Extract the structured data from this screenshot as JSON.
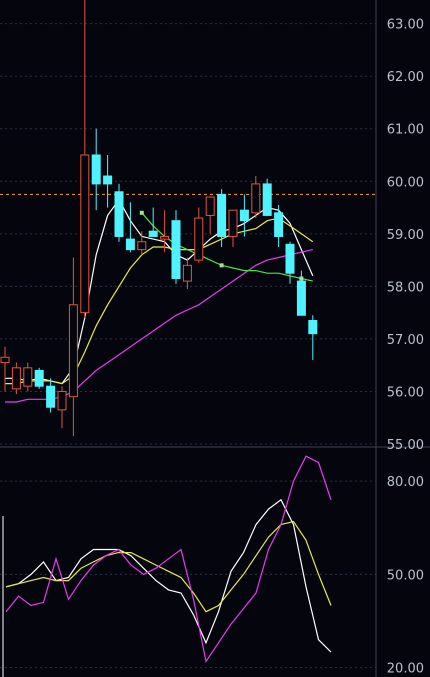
{
  "chart_data": [
    {
      "type": "candlestick",
      "panel": "price",
      "title": "",
      "xlabel": "",
      "ylabel": "",
      "ylim": [
        55.0,
        63.45
      ],
      "yticks": [
        "63.00",
        "62.00",
        "61.00",
        "60.00",
        "59.00",
        "58.00",
        "57.00",
        "56.00",
        "55.00"
      ],
      "grid": true,
      "reference_line": {
        "value": 59.75,
        "color": "#e08a2e",
        "style": "dashed"
      },
      "colors": {
        "up": "#e0553a",
        "down": "#4ff3ff",
        "background": "#05060d"
      },
      "candles": [
        {
          "open": 56.55,
          "high": 56.85,
          "low": 56.0,
          "close": 56.65
        },
        {
          "open": 56.05,
          "high": 56.55,
          "low": 55.95,
          "close": 56.45
        },
        {
          "open": 56.1,
          "high": 56.55,
          "low": 56.0,
          "close": 56.45
        },
        {
          "open": 56.4,
          "high": 56.45,
          "low": 56.05,
          "close": 56.1
        },
        {
          "open": 56.1,
          "high": 56.25,
          "low": 55.6,
          "close": 55.7
        },
        {
          "open": 55.65,
          "high": 56.1,
          "low": 55.3,
          "close": 56.0
        },
        {
          "open": 55.9,
          "high": 58.55,
          "low": 55.15,
          "close": 57.65
        },
        {
          "open": 57.5,
          "high": 63.5,
          "low": 57.4,
          "close": 60.5
        },
        {
          "open": 60.5,
          "high": 61.0,
          "low": 59.45,
          "close": 59.95
        },
        {
          "open": 60.1,
          "high": 60.5,
          "low": 59.5,
          "close": 59.95
        },
        {
          "open": 59.8,
          "high": 59.95,
          "low": 58.85,
          "close": 58.95
        },
        {
          "open": 58.9,
          "high": 59.6,
          "low": 58.65,
          "close": 58.7
        },
        {
          "open": 58.7,
          "high": 59.05,
          "low": 58.6,
          "close": 58.85
        },
        {
          "open": 59.05,
          "high": 59.5,
          "low": 58.95,
          "close": 58.95
        },
        {
          "open": 58.9,
          "high": 59.45,
          "low": 58.65,
          "close": 58.95
        },
        {
          "open": 59.25,
          "high": 59.45,
          "low": 58.05,
          "close": 58.15
        },
        {
          "open": 58.1,
          "high": 58.55,
          "low": 57.95,
          "close": 58.4
        },
        {
          "open": 58.5,
          "high": 59.5,
          "low": 58.45,
          "close": 59.3
        },
        {
          "open": 59.35,
          "high": 59.7,
          "low": 59.0,
          "close": 59.7
        },
        {
          "open": 59.75,
          "high": 59.85,
          "low": 58.75,
          "close": 58.95
        },
        {
          "open": 58.95,
          "high": 59.45,
          "low": 58.75,
          "close": 59.45
        },
        {
          "open": 59.45,
          "high": 59.75,
          "low": 58.95,
          "close": 59.25
        },
        {
          "open": 59.4,
          "high": 60.1,
          "low": 59.3,
          "close": 59.95
        },
        {
          "open": 59.95,
          "high": 60.05,
          "low": 59.35,
          "close": 59.35
        },
        {
          "open": 59.4,
          "high": 59.55,
          "low": 58.75,
          "close": 58.95
        },
        {
          "open": 58.8,
          "high": 58.85,
          "low": 58.05,
          "close": 58.25
        },
        {
          "open": 58.1,
          "high": 58.3,
          "low": 57.45,
          "close": 57.45
        },
        {
          "open": 57.35,
          "high": 57.45,
          "low": 56.6,
          "close": 57.1
        }
      ],
      "series": [
        {
          "color": "#ffffff",
          "values": [
            56.25,
            56.25,
            56.2,
            56.25,
            56.2,
            56.15,
            56.45,
            57.4,
            58.6,
            59.35,
            59.65,
            59.25,
            58.95,
            58.9,
            58.85,
            58.6,
            58.5,
            58.7,
            58.9,
            59.05,
            59.1,
            59.2,
            59.35,
            59.5,
            59.45,
            59.2,
            58.7,
            58.2
          ]
        },
        {
          "color": "#e8e84a",
          "values": [
            56.15,
            56.15,
            56.2,
            56.2,
            56.2,
            56.15,
            56.3,
            56.75,
            57.25,
            57.65,
            58.0,
            58.35,
            58.6,
            58.75,
            58.75,
            58.7,
            58.7,
            58.7,
            58.8,
            58.9,
            59.0,
            59.05,
            59.1,
            59.25,
            59.3,
            59.15,
            59.0,
            58.85
          ]
        },
        {
          "color": "#e83cf0",
          "values": [
            55.8,
            55.8,
            55.85,
            55.85,
            55.85,
            55.9,
            56.0,
            56.2,
            56.4,
            56.55,
            56.7,
            56.85,
            57.0,
            57.15,
            57.3,
            57.45,
            57.55,
            57.65,
            57.8,
            57.95,
            58.1,
            58.25,
            58.4,
            58.5,
            58.55,
            58.6,
            58.65,
            58.7
          ]
        },
        {
          "color": "#4ce24c",
          "start_index": 12,
          "values": [
            59.4,
            59.15,
            58.95,
            58.8,
            58.7,
            58.6,
            58.5,
            58.4,
            58.35,
            58.3,
            58.3,
            58.25,
            58.25,
            58.2,
            58.15,
            58.1
          ]
        }
      ]
    },
    {
      "type": "line",
      "panel": "indicator",
      "title": "",
      "xlabel": "",
      "ylabel": "",
      "ylim": [
        17,
        90
      ],
      "yticks": [
        "80.00",
        "50.00",
        "20.00"
      ],
      "grid": true,
      "series": [
        {
          "color": "#ffffff",
          "values": [
            46,
            47,
            50,
            54,
            48,
            49,
            55,
            58,
            58,
            58,
            56,
            52,
            48,
            45,
            44,
            37,
            28,
            38,
            51,
            57,
            66,
            71,
            74,
            66,
            46,
            29,
            25
          ]
        },
        {
          "color": "#e8e84a",
          "values": [
            46,
            47,
            48,
            49,
            48,
            48,
            52,
            54,
            56,
            57,
            57,
            55,
            53,
            51,
            49,
            44,
            38,
            40,
            45,
            50,
            56,
            62,
            66,
            67,
            61,
            50,
            40
          ]
        },
        {
          "color": "#e83cf0",
          "values": [
            38,
            43,
            40,
            41,
            55,
            42,
            48,
            53,
            56,
            58,
            53,
            50,
            52,
            55,
            58,
            42,
            22,
            28,
            34,
            39,
            44,
            58,
            66,
            80,
            88,
            86,
            74
          ]
        }
      ]
    }
  ]
}
